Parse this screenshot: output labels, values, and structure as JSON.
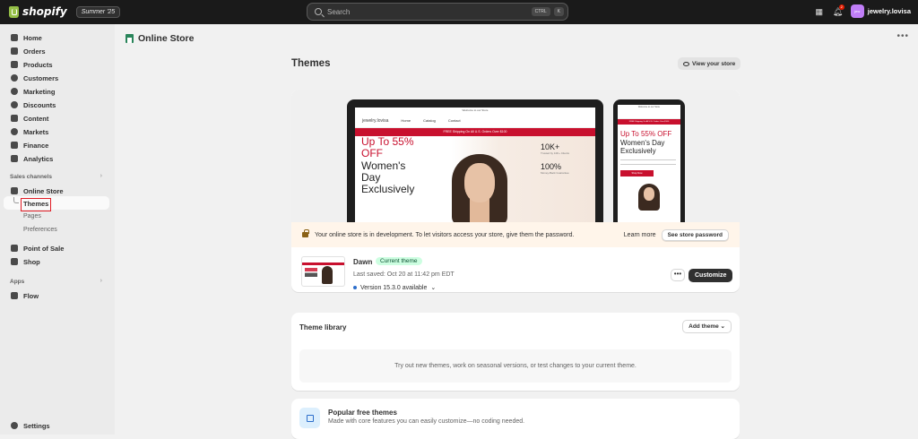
{
  "topbar": {
    "brand": "shopify",
    "edition": "Summer '25",
    "search_placeholder": "Search",
    "shortcut_ctrl": "CTRL",
    "shortcut_key": "K",
    "notification_count": "2",
    "avatar_initials": "jew",
    "store_name": "jewelry.lovisa"
  },
  "sidebar": {
    "items": [
      {
        "label": "Home",
        "icon": "home-icon"
      },
      {
        "label": "Orders",
        "icon": "orders-icon"
      },
      {
        "label": "Products",
        "icon": "tag-icon"
      },
      {
        "label": "Customers",
        "icon": "person-icon"
      },
      {
        "label": "Marketing",
        "icon": "target-icon"
      },
      {
        "label": "Discounts",
        "icon": "discount-icon"
      },
      {
        "label": "Content",
        "icon": "content-icon"
      },
      {
        "label": "Markets",
        "icon": "globe-icon"
      },
      {
        "label": "Finance",
        "icon": "bank-icon"
      },
      {
        "label": "Analytics",
        "icon": "chart-icon"
      }
    ],
    "sales_channels_label": "Sales channels",
    "online_store": "Online Store",
    "sub_items": {
      "themes": "Themes",
      "pages": "Pages",
      "preferences": "Preferences"
    },
    "point_of_sale": "Point of Sale",
    "shop": "Shop",
    "apps_label": "Apps",
    "flow": "Flow",
    "settings": "Settings"
  },
  "header": {
    "title": "Online Store"
  },
  "themes": {
    "title": "Themes",
    "view_store": "View your store",
    "preview": {
      "announcement": "Welcome to our Store",
      "brand": "jewelry.lovisa",
      "nav": [
        "Home",
        "Catalog",
        "Contact"
      ],
      "shipping_bar": "FREE Shipping On All U.S. Orders Over $100",
      "hero_red": "Up To 55% OFF",
      "hero_black": "Women's Day Exclusively",
      "stat1_num": "10K+",
      "stat1_sub": "Trusted by 10K+ Clients",
      "stat2_num": "100%",
      "stat2_sub": "Money-Back Guarantee",
      "phone_button": "Shop Now"
    },
    "notice": {
      "text": "Your online store is in development. To let visitors access your store, give them the password.",
      "learn_more": "Learn more",
      "button": "See store password"
    },
    "current": {
      "name": "Dawn",
      "badge": "Current theme",
      "last_saved": "Last saved: Oct 20 at 11:42 pm EDT",
      "version": "Version 15.3.0 available",
      "more": "•••",
      "customize": "Customize"
    }
  },
  "library": {
    "title": "Theme library",
    "add_theme": "Add theme",
    "empty_text": "Try out new themes, work on seasonal versions, or test changes to your current theme."
  },
  "popular": {
    "title": "Popular free themes",
    "subtitle": "Made with core features you can easily customize—no coding needed."
  }
}
